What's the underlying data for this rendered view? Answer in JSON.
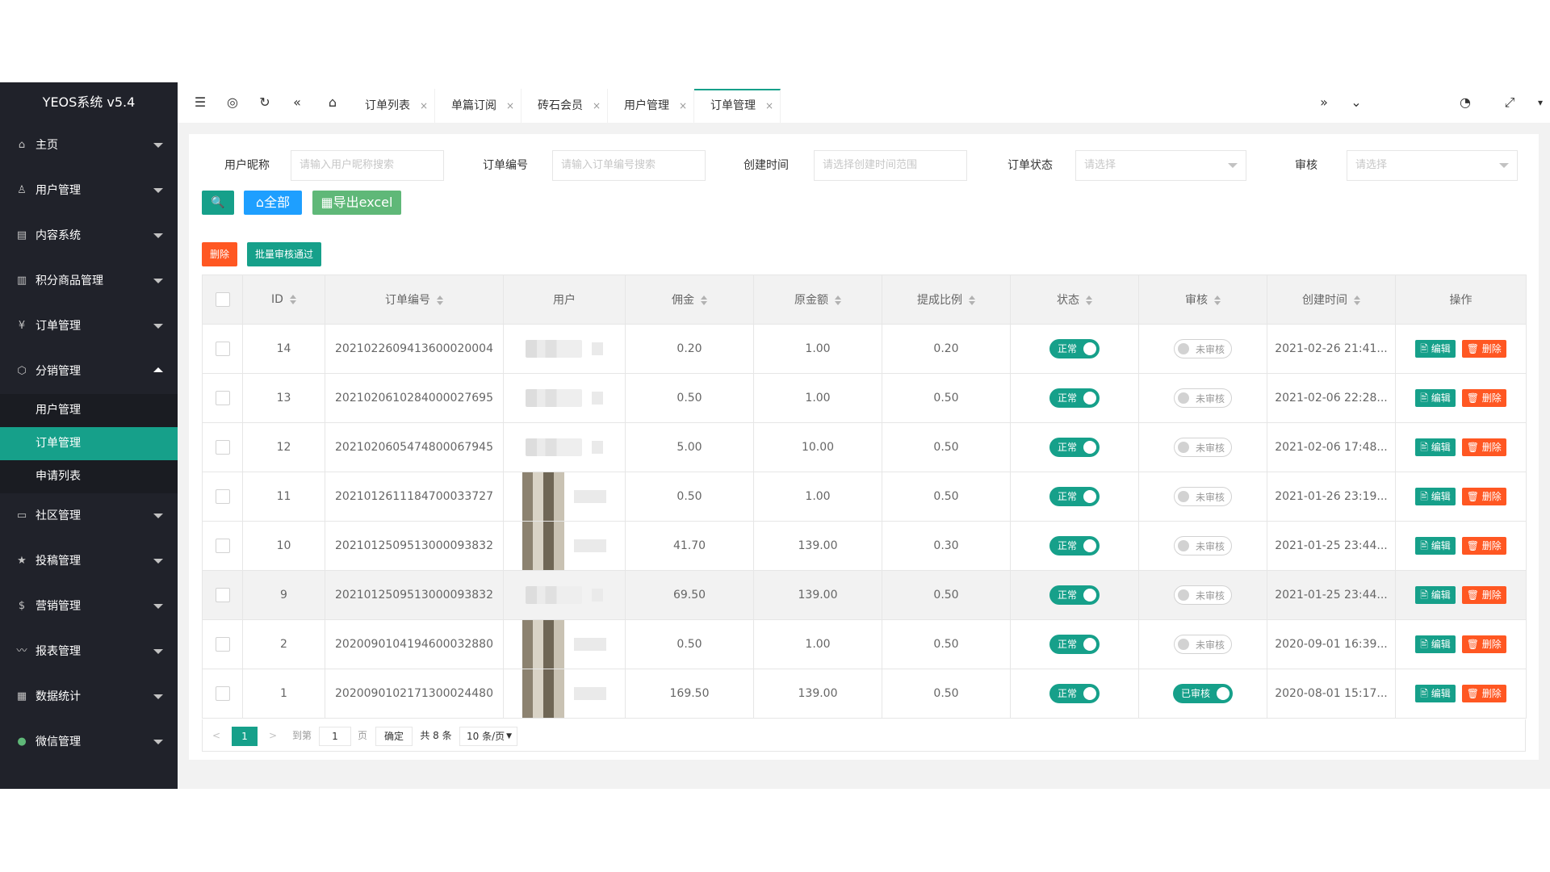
{
  "sidebar": {
    "logo": "YEOS系统 v5.4",
    "items": [
      {
        "label": "主页",
        "icon": "home-icon"
      },
      {
        "label": "用户管理",
        "icon": "user-icon"
      },
      {
        "label": "内容系统",
        "icon": "content-icon"
      },
      {
        "label": "积分商品管理",
        "icon": "goods-icon"
      },
      {
        "label": "订单管理",
        "icon": "yen-icon"
      },
      {
        "label": "分销管理",
        "icon": "cube-icon"
      }
    ],
    "submenu": [
      {
        "label": "用户管理"
      },
      {
        "label": "订单管理"
      },
      {
        "label": "申请列表"
      }
    ],
    "items2": [
      {
        "label": "社区管理",
        "icon": "community-icon"
      },
      {
        "label": "投稿管理",
        "icon": "star-icon"
      },
      {
        "label": "营销管理",
        "icon": "dollar-icon"
      },
      {
        "label": "报表管理",
        "icon": "chart-icon"
      },
      {
        "label": "数据统计",
        "icon": "data-icon"
      },
      {
        "label": "微信管理",
        "icon": "wechat-icon"
      }
    ]
  },
  "topbar": {
    "icons": [
      "☰",
      "◎",
      "↻",
      "«",
      "⌂"
    ],
    "tabs": [
      {
        "label": "订单列表"
      },
      {
        "label": "单篇订阅"
      },
      {
        "label": "砖石会员"
      },
      {
        "label": "用户管理"
      },
      {
        "label": "订单管理"
      }
    ],
    "close_glyph": "×",
    "right_icons": [
      "»",
      "⌄",
      "◔",
      "⤢",
      "▾"
    ]
  },
  "filters": {
    "nickname_label": "用户昵称",
    "nickname_placeholder": "请输入用户昵称搜索",
    "order_no_label": "订单编号",
    "order_no_placeholder": "请输入订单编号搜索",
    "created_label": "创建时间",
    "created_placeholder": "请选择创建时间范围",
    "status_label": "订单状态",
    "status_placeholder": "请选择",
    "audit_label": "审核",
    "audit_placeholder": "请选择"
  },
  "buttons": {
    "search": "🔍",
    "all": "⌂全部",
    "export": "▦导出excel",
    "delete": "删除",
    "batch_audit": "批量审核通过"
  },
  "table": {
    "headers": [
      "ID",
      "订单编号",
      "用户",
      "佣金",
      "原金额",
      "提成比例",
      "状态",
      "审核",
      "创建时间",
      "操作"
    ],
    "rows": [
      {
        "id": "14",
        "order_no": "2021022609413600020004",
        "commission": "0.20",
        "amount": "1.00",
        "rate": "0.20",
        "status": "正常",
        "audit": "未审核",
        "audited": false,
        "created": "2021-02-26 21:41...",
        "avatar": "blur"
      },
      {
        "id": "13",
        "order_no": "2021020610284000027695",
        "commission": "0.50",
        "amount": "1.00",
        "rate": "0.50",
        "status": "正常",
        "audit": "未审核",
        "audited": false,
        "created": "2021-02-06 22:28...",
        "avatar": "blur"
      },
      {
        "id": "12",
        "order_no": "2021020605474800067945",
        "commission": "5.00",
        "amount": "10.00",
        "rate": "0.50",
        "status": "正常",
        "audit": "未审核",
        "audited": false,
        "created": "2021-02-06 17:48...",
        "avatar": "blur"
      },
      {
        "id": "11",
        "order_no": "2021012611184700033727",
        "commission": "0.50",
        "amount": "1.00",
        "rate": "0.50",
        "status": "正常",
        "audit": "未审核",
        "audited": false,
        "created": "2021-01-26 23:19...",
        "avatar": "img"
      },
      {
        "id": "10",
        "order_no": "2021012509513000093832",
        "commission": "41.70",
        "amount": "139.00",
        "rate": "0.30",
        "status": "正常",
        "audit": "未审核",
        "audited": false,
        "created": "2021-01-25 23:44...",
        "avatar": "img"
      },
      {
        "id": "9",
        "order_no": "2021012509513000093832",
        "commission": "69.50",
        "amount": "139.00",
        "rate": "0.50",
        "status": "正常",
        "audit": "未审核",
        "audited": false,
        "created": "2021-01-25 23:44...",
        "avatar": "blur"
      },
      {
        "id": "2",
        "order_no": "2020090104194600032880",
        "commission": "0.50",
        "amount": "1.00",
        "rate": "0.50",
        "status": "正常",
        "audit": "未审核",
        "audited": false,
        "created": "2020-09-01 16:39...",
        "avatar": "img"
      },
      {
        "id": "1",
        "order_no": "2020090102171300024480",
        "commission": "169.50",
        "amount": "139.00",
        "rate": "0.50",
        "status": "正常",
        "audit": "已审核",
        "audited": true,
        "created": "2020-08-01 15:17...",
        "avatar": "img"
      }
    ],
    "edit_label": "🖹 编辑",
    "delete_label": "🗑 删除"
  },
  "pager": {
    "prev": "<",
    "current": "1",
    "next": ">",
    "goto_label": "到第",
    "goto_value": "1",
    "page_unit": "页",
    "confirm": "确定",
    "total": "共 8 条",
    "page_size": "10 条/页"
  },
  "colors": {
    "sidebar": "#20222a",
    "accent": "#16a08a",
    "danger": "#ff5722",
    "blue": "#1e9fff",
    "export_green": "#5fb878"
  }
}
